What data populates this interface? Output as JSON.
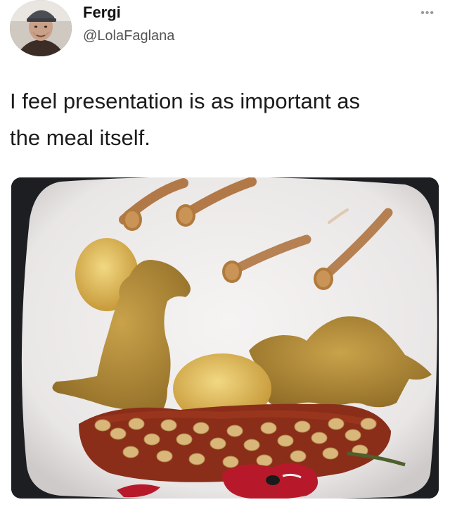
{
  "user": {
    "display_name": "Fergi",
    "handle": "@LolaFaglana"
  },
  "menu": {
    "more_label": "•••"
  },
  "tweet": {
    "text_line1": "I feel presentation is as important as",
    "text_line2": "the meal itself."
  },
  "icons": {
    "more": "more-options-icon",
    "avatar": "user-avatar"
  },
  "colors": {
    "text": "#1b1b1b",
    "handle": "#555555",
    "background": "#ffffff"
  }
}
